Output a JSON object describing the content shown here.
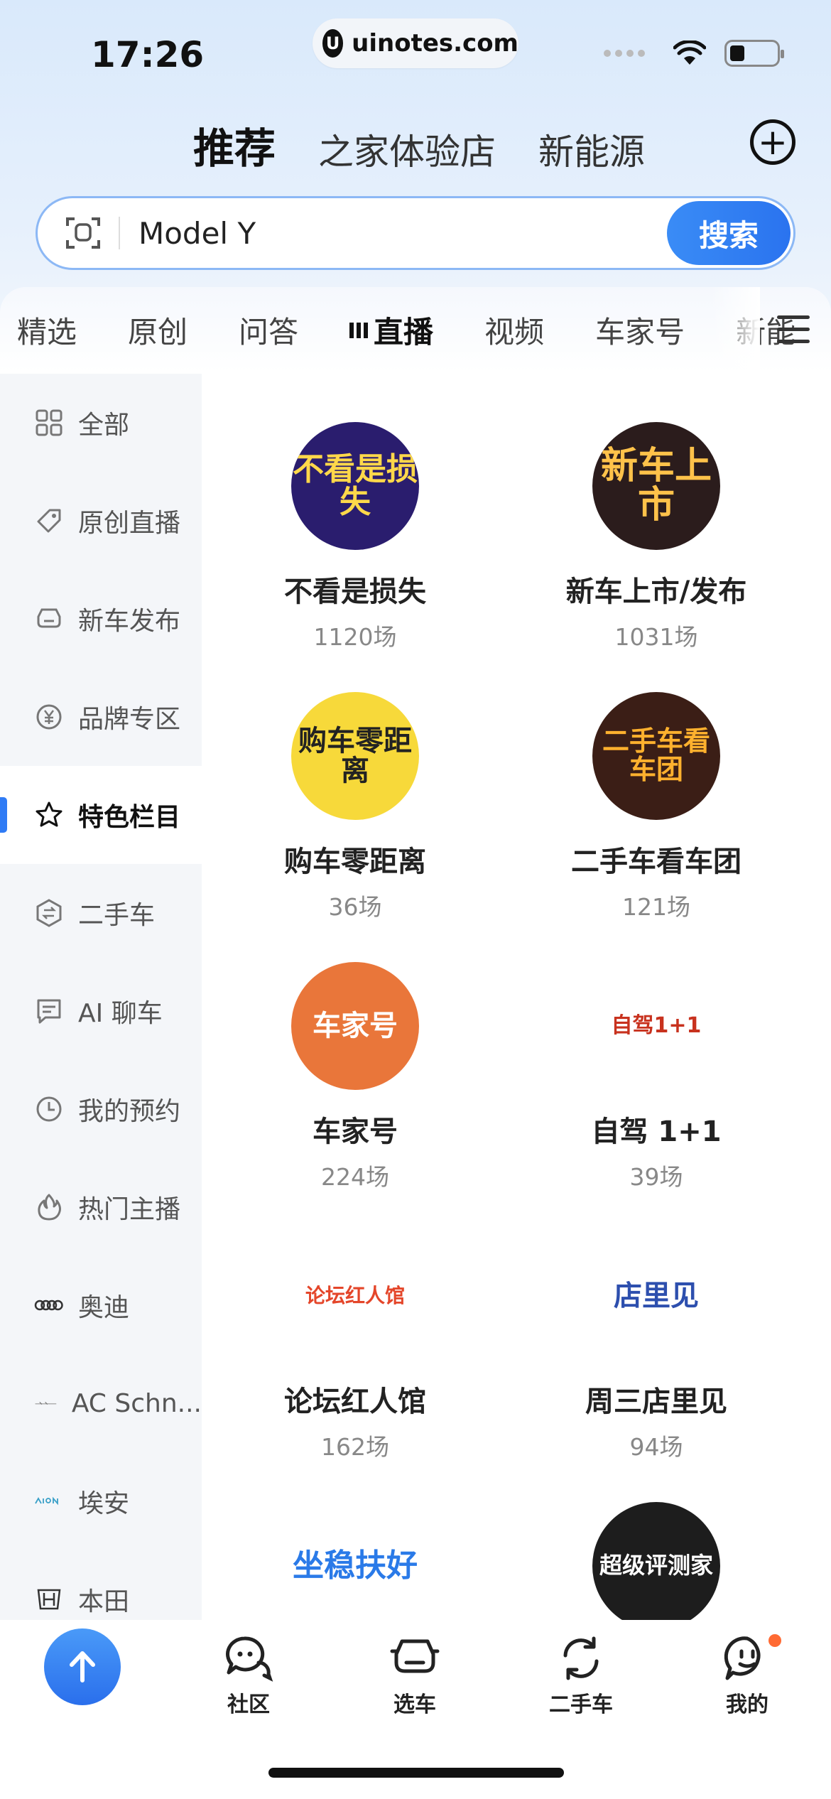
{
  "status": {
    "time": "17:26",
    "url": "uinotes.com",
    "url_logo": "U"
  },
  "top_tabs": [
    "推荐",
    "之家体验店",
    "新能源"
  ],
  "add_icon": "plus-circle-icon",
  "search": {
    "value": "Model Y",
    "button": "搜索",
    "scan_icon": "scan-icon"
  },
  "categories": [
    "精选",
    "原创",
    "问答",
    "直播",
    "视频",
    "车家号",
    "新能"
  ],
  "active_category": "直播",
  "sidebar": {
    "items": [
      {
        "label": "全部",
        "icon": "grid-icon"
      },
      {
        "label": "原创直播",
        "icon": "tag-icon"
      },
      {
        "label": "新车发布",
        "icon": "car-icon"
      },
      {
        "label": "品牌专区",
        "icon": "yen-icon"
      },
      {
        "label": "特色栏目",
        "icon": "star-icon"
      },
      {
        "label": "二手车",
        "icon": "exchange-icon"
      },
      {
        "label": "AI 聊车",
        "icon": "chat-icon"
      },
      {
        "label": "我的预约",
        "icon": "clock-icon"
      },
      {
        "label": "热门主播",
        "icon": "flame-icon"
      },
      {
        "label": "奥迪",
        "icon": "audi-logo-icon"
      },
      {
        "label": "AC Schn...",
        "icon": "ac-schnitzer-logo-icon"
      },
      {
        "label": "埃安",
        "icon": "aion-logo-icon"
      },
      {
        "label": "本田",
        "icon": "honda-logo-icon"
      }
    ],
    "active_index": 4
  },
  "programs": [
    {
      "name": "不看是损失",
      "count": "1120场",
      "logo_text": "不看是损失",
      "bg": "#2a1d6e",
      "fg": "#ffd84a"
    },
    {
      "name": "新车上市/发布",
      "count": "1031场",
      "logo_text": "新车上市",
      "bg": "#2b1c1c",
      "fg": "#ffc24a"
    },
    {
      "name": "购车零距离",
      "count": "36场",
      "logo_text": "购车零距离",
      "bg": "#f7d93a",
      "fg": "#222222"
    },
    {
      "name": "二手车看车团",
      "count": "121场",
      "logo_text": "二手车看车团",
      "bg": "#3b1e16",
      "fg": "#ffb12e"
    },
    {
      "name": "车家号",
      "count": "224场",
      "logo_text": "车家号",
      "bg": "#e9763a",
      "fg": "#ffffff"
    },
    {
      "name": "自驾 1+1",
      "count": "39场",
      "logo_text": "自驾1+1",
      "bg": "#ffffff",
      "fg": "#c8321e"
    },
    {
      "name": "论坛红人馆",
      "count": "162场",
      "logo_text": "论坛红人馆",
      "bg": "#ffffff",
      "fg": "#e4462a"
    },
    {
      "name": "周三店里见",
      "count": "94场",
      "logo_text": "店里见",
      "bg": "#ffffff",
      "fg": "#2d4fae"
    },
    {
      "name": "",
      "count": "",
      "logo_text": "坐稳扶好",
      "bg": "#ffffff",
      "fg": "#2a7ae8"
    },
    {
      "name": "",
      "count": "",
      "logo_text": "超级评测家",
      "bg": "#1d1d1d",
      "fg": "#ffffff"
    }
  ],
  "bottom_nav": [
    {
      "label": "社区",
      "icon": "community-icon"
    },
    {
      "label": "选车",
      "icon": "car-select-icon"
    },
    {
      "label": "二手车",
      "icon": "refresh-car-icon"
    },
    {
      "label": "我的",
      "icon": "profile-icon"
    }
  ],
  "colors": {
    "accent": "#2f7bf5",
    "badge": "#ff6a33"
  }
}
